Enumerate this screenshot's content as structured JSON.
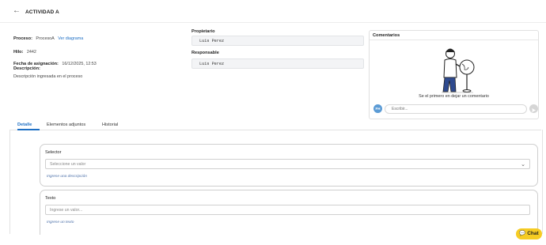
{
  "header": {
    "back_icon": "arrow-left-icon",
    "title": "ACTIVIDAD A"
  },
  "details": {
    "process_label": "Proceso:",
    "process_value": "ProcesoA",
    "process_link": "Ver diagrama",
    "thread_label": "Hilo:",
    "thread_value": "2442",
    "assigned_label": "Fecha de asignación:",
    "assigned_value": "16/12/2025, 12:53",
    "description_label": "Descripción:",
    "description_value": "Descripción ingresada en el proceso"
  },
  "people": {
    "owner_label": "Propietario",
    "owner_value": "Luis Perez",
    "responsible_label": "Responsable",
    "responsible_value": "Luis Perez"
  },
  "comments": {
    "title": "Comentarios",
    "empty_message": "Se el primero en dejar un comentario",
    "avatar_initials": "FH",
    "input_placeholder": "Escribir...",
    "send_icon": "send-icon",
    "illustration": "person-with-globe-illustration"
  },
  "tabs": [
    {
      "label": "Detalle",
      "active": true
    },
    {
      "label": "Elementos adjuntos",
      "active": false
    },
    {
      "label": "Historial",
      "active": false
    }
  ],
  "form": {
    "selector": {
      "label": "Selector",
      "placeholder": "Seleccione un valor",
      "hint": "Ingrese una descripción",
      "icon": "chevron-down-icon"
    },
    "text": {
      "label": "Texto",
      "placeholder": "Ingrese un valor...",
      "hint": "Ingrese un texto"
    }
  },
  "chat_button": {
    "label": "Chat",
    "icon": "chat-bubble-icon"
  },
  "colors": {
    "link": "#1e6fc4",
    "chat": "#f6cc23",
    "avatar": "#5b9bd5"
  }
}
